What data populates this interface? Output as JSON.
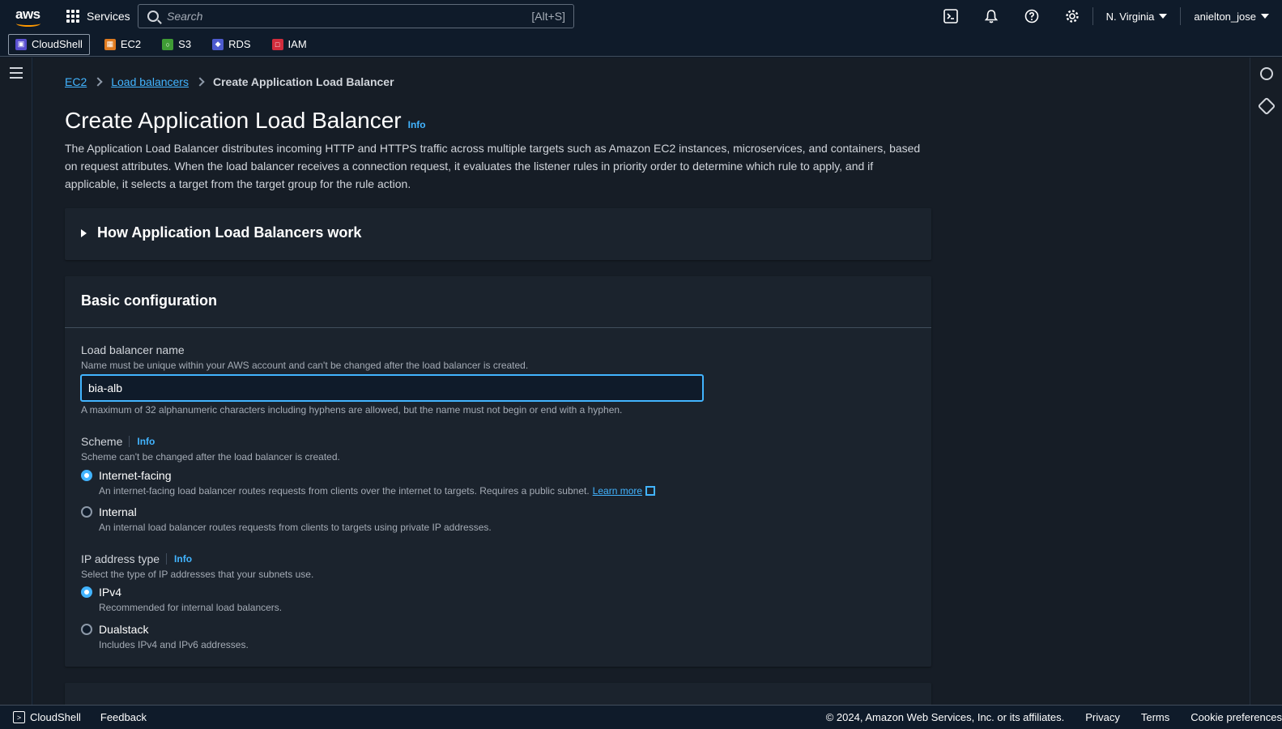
{
  "topnav": {
    "logo_text": "aws",
    "services_label": "Services",
    "search_placeholder": "Search",
    "search_shortcut": "[Alt+S]",
    "region": "N. Virginia",
    "user": "anielton_jose"
  },
  "shortcuts": [
    {
      "label": "CloudShell",
      "color": "#5a4fcf"
    },
    {
      "label": "EC2",
      "color": "#e07b1f"
    },
    {
      "label": "S3",
      "color": "#3f9c35"
    },
    {
      "label": "RDS",
      "color": "#4d5bcf"
    },
    {
      "label": "IAM",
      "color": "#d12c3c"
    }
  ],
  "breadcrumb": {
    "items": [
      "EC2",
      "Load balancers"
    ],
    "current": "Create Application Load Balancer"
  },
  "page": {
    "title": "Create Application Load Balancer",
    "title_info": "Info",
    "description": "The Application Load Balancer distributes incoming HTTP and HTTPS traffic across multiple targets such as Amazon EC2 instances, microservices, and containers, based on request attributes. When the load balancer receives a connection request, it evaluates the listener rules in priority order to determine which rule to apply, and if applicable, it selects a target from the target group for the rule action."
  },
  "how_it_works": {
    "title": "How Application Load Balancers work"
  },
  "basic_config": {
    "title": "Basic configuration",
    "name_label": "Load balancer name",
    "name_hint": "Name must be unique within your AWS account and can't be changed after the load balancer is created.",
    "name_value": "bia-alb",
    "name_constraint": "A maximum of 32 alphanumeric characters including hyphens are allowed, but the name must not begin or end with a hyphen.",
    "scheme_label": "Scheme",
    "scheme_info": "Info",
    "scheme_hint": "Scheme can't be changed after the load balancer is created.",
    "scheme_options": [
      {
        "label": "Internet-facing",
        "desc": "An internet-facing load balancer routes requests from clients over the internet to targets. Requires a public subnet.",
        "link": "Learn more",
        "selected": true
      },
      {
        "label": "Internal",
        "desc": "An internal load balancer routes requests from clients to targets using private IP addresses.",
        "selected": false
      }
    ],
    "ip_label": "IP address type",
    "ip_info": "Info",
    "ip_hint": "Select the type of IP addresses that your subnets use.",
    "ip_options": [
      {
        "label": "IPv4",
        "desc": "Recommended for internal load balancers.",
        "selected": true
      },
      {
        "label": "Dualstack",
        "desc": "Includes IPv4 and IPv6 addresses.",
        "selected": false
      }
    ]
  },
  "footer": {
    "cloudshell": "CloudShell",
    "feedback": "Feedback",
    "copyright": "© 2024, Amazon Web Services, Inc. or its affiliates.",
    "privacy": "Privacy",
    "terms": "Terms",
    "cookies": "Cookie preferences"
  }
}
